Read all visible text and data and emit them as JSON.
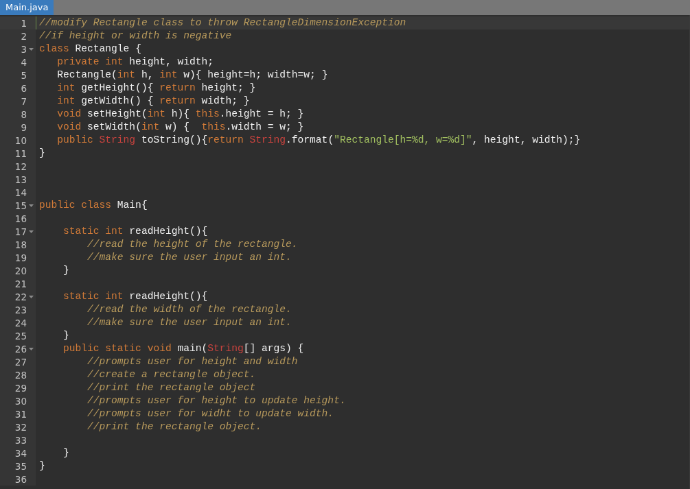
{
  "tabs": [
    {
      "label": "Main.java",
      "selected": true
    }
  ],
  "lines": [
    {
      "number": "1",
      "fold": false,
      "active": true,
      "tokens": [
        {
          "kind": "comment",
          "text": "//modify Rectangle class to throw RectangleDimensionException"
        }
      ]
    },
    {
      "number": "2",
      "fold": false,
      "active": false,
      "tokens": [
        {
          "kind": "comment",
          "text": "//if height or width is negative"
        }
      ]
    },
    {
      "number": "3",
      "fold": true,
      "active": false,
      "tokens": [
        {
          "kind": "keyword",
          "text": "class"
        },
        {
          "kind": "plain",
          "text": " Rectangle {"
        }
      ]
    },
    {
      "number": "4",
      "fold": false,
      "active": false,
      "tokens": [
        {
          "kind": "keyword",
          "text": "   private int"
        },
        {
          "kind": "plain",
          "text": " height, width;"
        }
      ]
    },
    {
      "number": "5",
      "fold": false,
      "active": false,
      "tokens": [
        {
          "kind": "plain",
          "text": "   Rectangle("
        },
        {
          "kind": "keyword",
          "text": "int"
        },
        {
          "kind": "plain",
          "text": " h, "
        },
        {
          "kind": "keyword",
          "text": "int"
        },
        {
          "kind": "plain",
          "text": " w){ height=h; width=w; }"
        }
      ]
    },
    {
      "number": "6",
      "fold": false,
      "active": false,
      "tokens": [
        {
          "kind": "keyword",
          "text": "   int"
        },
        {
          "kind": "plain",
          "text": " getHeight(){ "
        },
        {
          "kind": "keyword",
          "text": "return"
        },
        {
          "kind": "plain",
          "text": " height; }"
        }
      ]
    },
    {
      "number": "7",
      "fold": false,
      "active": false,
      "tokens": [
        {
          "kind": "keyword",
          "text": "   int"
        },
        {
          "kind": "plain",
          "text": " getWidth() { "
        },
        {
          "kind": "keyword",
          "text": "return"
        },
        {
          "kind": "plain",
          "text": " width; }"
        }
      ]
    },
    {
      "number": "8",
      "fold": false,
      "active": false,
      "tokens": [
        {
          "kind": "keyword",
          "text": "   void"
        },
        {
          "kind": "plain",
          "text": " setHeight("
        },
        {
          "kind": "keyword",
          "text": "int"
        },
        {
          "kind": "plain",
          "text": " h){ "
        },
        {
          "kind": "keyword",
          "text": "this"
        },
        {
          "kind": "plain",
          "text": ".height = h; }"
        }
      ]
    },
    {
      "number": "9",
      "fold": false,
      "active": false,
      "tokens": [
        {
          "kind": "keyword",
          "text": "   void"
        },
        {
          "kind": "plain",
          "text": " setWidth("
        },
        {
          "kind": "keyword",
          "text": "int"
        },
        {
          "kind": "plain",
          "text": " w) {  "
        },
        {
          "kind": "keyword",
          "text": "this"
        },
        {
          "kind": "plain",
          "text": ".width = w; }"
        }
      ]
    },
    {
      "number": "10",
      "fold": false,
      "active": false,
      "tokens": [
        {
          "kind": "keyword",
          "text": "   public "
        },
        {
          "kind": "type",
          "text": "String"
        },
        {
          "kind": "plain",
          "text": " toString(){"
        },
        {
          "kind": "keyword",
          "text": "return "
        },
        {
          "kind": "type",
          "text": "String"
        },
        {
          "kind": "plain",
          "text": ".format("
        },
        {
          "kind": "string",
          "text": "\"Rectangle[h=%d, w=%d]\""
        },
        {
          "kind": "plain",
          "text": ", height, width);}"
        }
      ]
    },
    {
      "number": "11",
      "fold": false,
      "active": false,
      "tokens": [
        {
          "kind": "plain",
          "text": "}"
        }
      ]
    },
    {
      "number": "12",
      "fold": false,
      "active": false
    },
    {
      "number": "13",
      "fold": false,
      "active": false
    },
    {
      "number": "14",
      "fold": false,
      "active": false
    },
    {
      "number": "15",
      "fold": true,
      "active": false,
      "tokens": [
        {
          "kind": "keyword",
          "text": "public class"
        },
        {
          "kind": "plain",
          "text": " Main{"
        }
      ]
    },
    {
      "number": "16",
      "fold": false,
      "active": false
    },
    {
      "number": "17",
      "fold": true,
      "active": false,
      "tokens": [
        {
          "kind": "keyword",
          "text": "    static int"
        },
        {
          "kind": "plain",
          "text": " readHeight(){"
        }
      ]
    },
    {
      "number": "18",
      "fold": false,
      "active": false,
      "tokens": [
        {
          "kind": "comment",
          "text": "        //read the height of the rectangle."
        }
      ]
    },
    {
      "number": "19",
      "fold": false,
      "active": false,
      "tokens": [
        {
          "kind": "comment",
          "text": "        //make sure the user input an int."
        }
      ]
    },
    {
      "number": "20",
      "fold": false,
      "active": false,
      "tokens": [
        {
          "kind": "plain",
          "text": "    }"
        }
      ]
    },
    {
      "number": "21",
      "fold": false,
      "active": false
    },
    {
      "number": "22",
      "fold": true,
      "active": false,
      "tokens": [
        {
          "kind": "keyword",
          "text": "    static int"
        },
        {
          "kind": "plain",
          "text": " readHeight(){"
        }
      ]
    },
    {
      "number": "23",
      "fold": false,
      "active": false,
      "tokens": [
        {
          "kind": "comment",
          "text": "        //read the width of the rectangle."
        }
      ]
    },
    {
      "number": "24",
      "fold": false,
      "active": false,
      "tokens": [
        {
          "kind": "comment",
          "text": "        //make sure the user input an int."
        }
      ]
    },
    {
      "number": "25",
      "fold": false,
      "active": false,
      "tokens": [
        {
          "kind": "plain",
          "text": "    }"
        }
      ]
    },
    {
      "number": "26",
      "fold": true,
      "active": false,
      "tokens": [
        {
          "kind": "keyword",
          "text": "    public static void"
        },
        {
          "kind": "plain",
          "text": " main("
        },
        {
          "kind": "type",
          "text": "String"
        },
        {
          "kind": "plain",
          "text": "[] args) {"
        }
      ]
    },
    {
      "number": "27",
      "fold": false,
      "active": false,
      "tokens": [
        {
          "kind": "comment",
          "text": "        //prompts user for height and width"
        }
      ]
    },
    {
      "number": "28",
      "fold": false,
      "active": false,
      "tokens": [
        {
          "kind": "comment",
          "text": "        //create a rectangle object."
        }
      ]
    },
    {
      "number": "29",
      "fold": false,
      "active": false,
      "tokens": [
        {
          "kind": "comment",
          "text": "        //print the rectangle object"
        }
      ]
    },
    {
      "number": "30",
      "fold": false,
      "active": false,
      "tokens": [
        {
          "kind": "comment",
          "text": "        //prompts user for height to update height."
        }
      ]
    },
    {
      "number": "31",
      "fold": false,
      "active": false,
      "tokens": [
        {
          "kind": "comment",
          "text": "        //prompts user for widht to update width."
        }
      ]
    },
    {
      "number": "32",
      "fold": false,
      "active": false,
      "tokens": [
        {
          "kind": "comment",
          "text": "        //print the rectangle object."
        }
      ]
    },
    {
      "number": "33",
      "fold": false,
      "active": false
    },
    {
      "number": "34",
      "fold": false,
      "active": false,
      "tokens": [
        {
          "kind": "plain",
          "text": "    }"
        }
      ]
    },
    {
      "number": "35",
      "fold": false,
      "active": false,
      "tokens": [
        {
          "kind": "plain",
          "text": "}"
        }
      ]
    },
    {
      "number": "36",
      "fold": false,
      "active": false
    }
  ]
}
